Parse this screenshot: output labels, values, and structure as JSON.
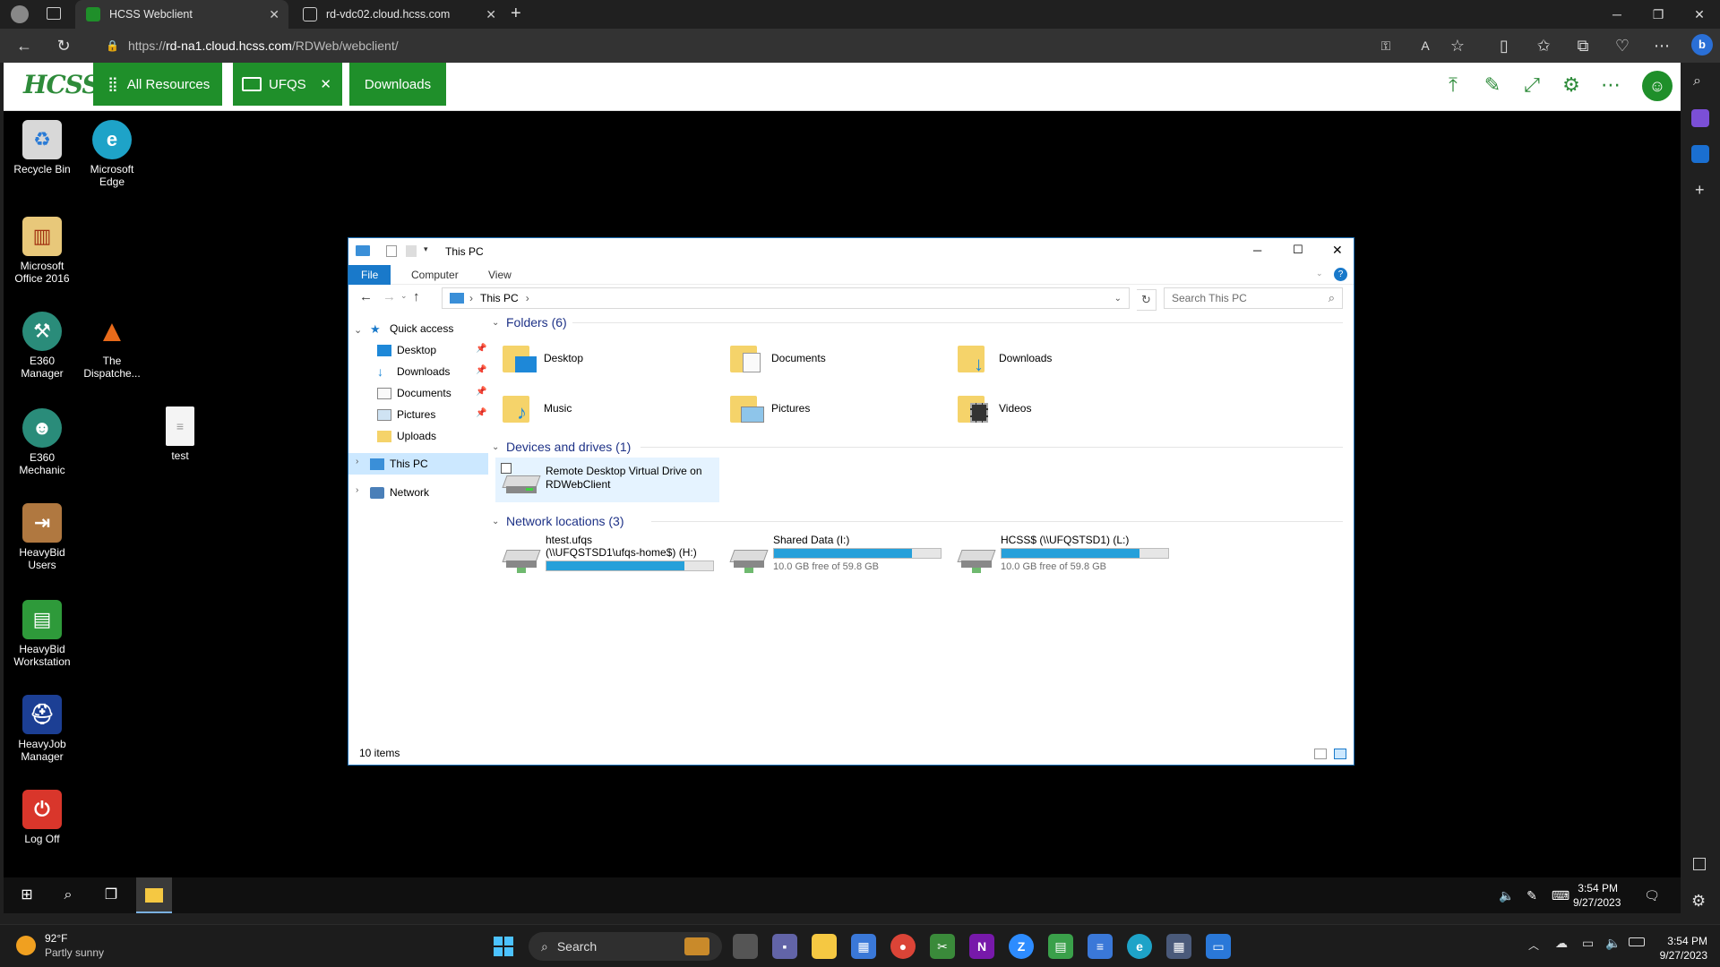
{
  "browser": {
    "tabs": [
      {
        "title": "HCSS Webclient",
        "active": true
      },
      {
        "title": "rd-vdc02.cloud.hcss.com",
        "active": false
      }
    ],
    "url_prefix": "https://",
    "url_host": "rd-na1.cloud.hcss.com",
    "url_path": "/RDWeb/webclient/"
  },
  "webclient": {
    "logo": "HCSS",
    "tabs": {
      "all_resources": "All Resources",
      "ufqs": "UFQS",
      "downloads": "Downloads"
    },
    "brand_color": "#1f8f2a"
  },
  "desktop": {
    "icons": [
      {
        "label": "Recycle Bin"
      },
      {
        "label": "Microsoft Edge"
      },
      {
        "label": "Microsoft Office 2016"
      },
      {
        "label": "E360 Manager"
      },
      {
        "label": "The Dispatche..."
      },
      {
        "label": "E360 Mechanic"
      },
      {
        "label": "test"
      },
      {
        "label": "HeavyBid Users"
      },
      {
        "label": "HeavyBid Workstation"
      },
      {
        "label": "HeavyJob Manager"
      },
      {
        "label": "Log Off"
      }
    ]
  },
  "explorer": {
    "title": "This PC",
    "ribbon": {
      "file": "File",
      "computer": "Computer",
      "view": "View"
    },
    "path": "This PC",
    "search_placeholder": "Search This PC",
    "nav": {
      "quick_access": "Quick access",
      "items": [
        "Desktop",
        "Downloads",
        "Documents",
        "Pictures",
        "Uploads"
      ],
      "this_pc": "This PC",
      "network": "Network"
    },
    "folders_header": "Folders (6)",
    "folders": [
      "Desktop",
      "Documents",
      "Downloads",
      "Music",
      "Pictures",
      "Videos"
    ],
    "devices_header": "Devices and drives (1)",
    "device": {
      "line1": "Remote Desktop Virtual Drive on",
      "line2": "RDWebClient"
    },
    "network_header": "Network locations (3)",
    "network_locations": [
      {
        "name": "htest.ufqs",
        "path": "(\\\\UFQSTSD1\\ufqs-home$) (H:)",
        "used": 0.83,
        "free": ""
      },
      {
        "name": "Shared Data (I:)",
        "path": "",
        "used": 0.83,
        "free": "10.0 GB free of 59.8 GB"
      },
      {
        "name": "HCSS$ (\\\\UFQSTSD1) (L:)",
        "path": "",
        "used": 0.83,
        "free": "10.0 GB free of 59.8 GB"
      }
    ],
    "status": "10 items"
  },
  "rd_taskbar": {
    "time": "3:54 PM",
    "date": "9/27/2023"
  },
  "taskbar": {
    "weather_temp": "92°F",
    "weather_desc": "Partly sunny",
    "search": "Search",
    "time": "3:54 PM",
    "date": "9/27/2023"
  }
}
